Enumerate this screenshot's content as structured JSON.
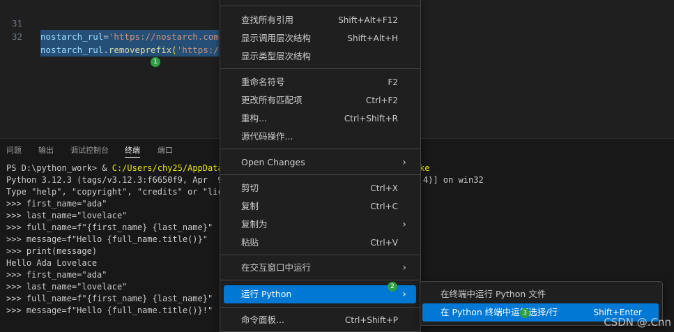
{
  "editor": {
    "lines": [
      {
        "number": "31",
        "var": "nostarch_rul",
        "eq": "=",
        "str": "'https://nostarch.com"
      },
      {
        "number": "32",
        "var": "nostarch_rul",
        "dot": ".",
        "fn": "removeprefix",
        "paren": "(",
        "str": "'https:/"
      }
    ],
    "markers": [
      "1",
      "2",
      "3"
    ]
  },
  "panel": {
    "tabs": [
      "问题",
      "输出",
      "调试控制台",
      "终端",
      "端口"
    ],
    "active_tab": "终端",
    "terminal": {
      "line0_prompt": "PS D:\\python_work> & ",
      "line0_path": "C:/Users/chy25/AppData/",
      "line0_tail": "ke",
      "line1": "Python 3.12.3 (tags/v3.12.3:f6650f9, Apr  9",
      "line1_tail": "4)] on win32",
      "line2": "Type \"help\", \"copyright\", \"credits\" or \"lice",
      "line3": ">>> first_name=\"ada\"",
      "line4": ">>> last_name=\"lovelace\"",
      "line5": ">>> full_name=f\"{first_name} {last_name}\"",
      "line6": ">>> message=f\"Hello {full_name.title()}\"",
      "line7": ">>> print(message)",
      "line8": "Hello Ada Lovelace",
      "line9": ">>> first_name=\"ada\"",
      "line10": ">>> last_name=\"lovelace\"",
      "line11": ">>> full_name=f\"{first_name} {last_name}\"",
      "line12": ">>> message=f\"Hello {full_name.title()}!\""
    }
  },
  "context_menu": {
    "find_all_refs": {
      "label": "查找所有引用",
      "key": "Shift+Alt+F12"
    },
    "call_hierarchy": {
      "label": "显示调用层次结构",
      "key": "Shift+Alt+H"
    },
    "type_hierarchy": {
      "label": "显示类型层次结构"
    },
    "rename": {
      "label": "重命名符号",
      "key": "F2"
    },
    "change_all": {
      "label": "更改所有匹配项",
      "key": "Ctrl+F2"
    },
    "refactor": {
      "label": "重构...",
      "key": "Ctrl+Shift+R"
    },
    "source_action": {
      "label": "源代码操作..."
    },
    "open_changes": {
      "label": "Open Changes"
    },
    "cut": {
      "label": "剪切",
      "key": "Ctrl+X"
    },
    "copy": {
      "label": "复制",
      "key": "Ctrl+C"
    },
    "copy_as": {
      "label": "复制为"
    },
    "paste": {
      "label": "粘贴",
      "key": "Ctrl+V"
    },
    "run_interactive": {
      "label": "在交互窗口中运行"
    },
    "run_python": {
      "label": "运行 Python"
    },
    "command_palette": {
      "label": "命令面板...",
      "key": "Ctrl+Shift+P"
    }
  },
  "submenu": {
    "run_file": {
      "label": "在终端中运行 Python 文件"
    },
    "run_selection": {
      "label": "在 Python 终端中运行选择/行",
      "key": "Shift+Enter"
    }
  },
  "watermark": "CSDN @.Cnn",
  "colors": {
    "accent": "#0078d4",
    "marker": "#2ea043",
    "selection": "#264f78"
  }
}
